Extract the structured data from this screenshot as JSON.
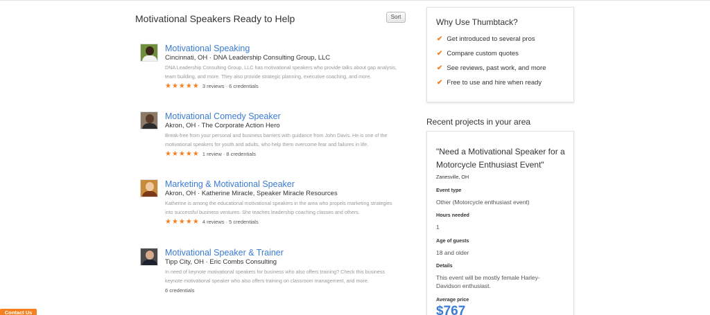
{
  "main": {
    "title": "Motivational Speakers Ready to Help",
    "sort_label": "Sort",
    "pros": [
      {
        "title": "Motivational Speaking",
        "location": "Cincinnati, OH",
        "company": "DNA Leadership Consulting Group, LLC",
        "description": "DNA Leadership Consulting Group, LLC has motivational speakers who provide talks about gap analysis, team building, and more. They also provide strategic planning, executive coaching, and more.",
        "stars": "★★★★★",
        "rating": 5,
        "meta": "3 reviews · 6 credentials"
      },
      {
        "title": "Motivational Comedy Speaker",
        "location": "Akron, OH",
        "company": "The Corporate Action Hero",
        "description": "Break-free from your personal and business barriers with guidance from John Davis. He is one of the motivational speakers for youth and adults, who help them overcome fear and failures in life.",
        "stars": "★★★★★",
        "rating": 5,
        "meta": "1 review · 8 credentials"
      },
      {
        "title": "Marketing & Motivational Speaker",
        "location": "Akron, OH",
        "company": "Katherine Miracle, Speaker Miracle Resources",
        "description": "Katherine is among the educational motivational speakers in the area who propels marketing strategies into successful business ventures. She teaches leadership coaching classes and others.",
        "stars": "★★★★★",
        "rating": 5,
        "meta": "4 reviews · 5 credentials"
      },
      {
        "title": "Motivational Speaker & Trainer",
        "location": "Tipp City, OH",
        "company": "Eric Combs Consulting",
        "description": "In need of keynote motivational speakers for business who also offers training? Check this business keynote motivational speaker who also offers training on classroom management, and more.",
        "meta": "6 credentials"
      }
    ]
  },
  "why": {
    "title": "Why Use Thumbtack?",
    "items": [
      "Get introduced to several pros",
      "Compare custom quotes",
      "See reviews, past work, and more",
      "Free to use and hire when ready"
    ]
  },
  "recent": {
    "section_title": "Recent projects in your area",
    "quote": "\"Need a Motivational Speaker for a Motorcycle Enthusiast Event\"",
    "location": "Zanesville, OH",
    "event_type_label": "Event type",
    "event_type_value": "Other (Motorcycle enthusiast event)",
    "hours_label": "Hours needed",
    "hours_value": "1",
    "age_label": "Age of guests",
    "age_value": "18 and older",
    "details_label": "Details",
    "details_value": "This event will be mostly female Harley-Davidson enthusiast.",
    "price_label": "Average price",
    "price_value": "$767"
  },
  "contact_label": "Contact Us",
  "colors": {
    "accent_orange": "#f4811f",
    "link_blue": "#3a7bd5"
  }
}
